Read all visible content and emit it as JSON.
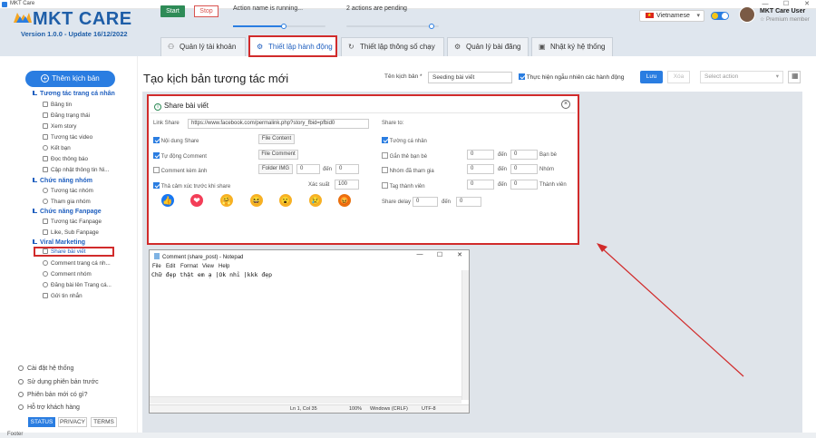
{
  "window": {
    "title": "MKT Care",
    "controls": [
      "—",
      "☐",
      "✕"
    ]
  },
  "header": {
    "logo_text": "MKT CARE",
    "version": "Version 1.0.0 - Update 16/12/2022",
    "start_label": "Start",
    "stop_label": "Stop",
    "status_running": "Action name is running...",
    "status_pending": "2 actions are pending",
    "running_progress": 0.55,
    "pending_progress": 0.92,
    "language": "Vietnamese",
    "user_name": "MKT Care User",
    "user_tier": "Premium member"
  },
  "tabs": [
    {
      "label": "Quản lý tài khoản",
      "icon": "account-icon"
    },
    {
      "label": "Thiết lập hành động",
      "icon": "gear-icon",
      "active": true
    },
    {
      "label": "Thiết lập thông số chạy",
      "icon": "refresh-icon"
    },
    {
      "label": "Quản lý bài đăng",
      "icon": "post-icon"
    },
    {
      "label": "Nhật ký hệ thống",
      "icon": "log-icon"
    }
  ],
  "sidebar": {
    "add_label": "Thêm kịch bản",
    "sections": [
      {
        "title": "Tương tác trang cá nhân",
        "items": [
          "Bảng tin",
          "Đăng trạng thái",
          "Xem story",
          "Tương tác video",
          "Kết bạn",
          "Đọc thông báo",
          "Cập nhật thông tin Ni..."
        ]
      },
      {
        "title": "Chức năng nhóm",
        "items": [
          "Tương tác nhóm",
          "Tham gia nhóm"
        ]
      },
      {
        "title": "Chức năng Fanpage",
        "items": [
          "Tương tác Fanpage",
          "Like, Sub Fanpage"
        ]
      },
      {
        "title": "Viral Marketing",
        "items": [
          "Share bài viết",
          "Comment trang cá nh...",
          "Comment nhóm",
          "Đăng bài lên Trang cá...",
          "Gửi tin nhắn"
        ]
      }
    ],
    "bottom": [
      "Cài đặt hệ thống",
      "Sử dụng phiên bản trước",
      "Phiên bản mới có gì?",
      "Hỗ trợ khách hàng"
    ],
    "footer_buttons": [
      "STATUS",
      "PRIVACY",
      "TERMS"
    ]
  },
  "main": {
    "title": "Tạo kịch bản tương tác mới",
    "script_name_label": "Tên kịch bản *",
    "script_name_value": "Seeding bài viết",
    "random_order_label": "Thực hiện ngẫu nhiên các hành động",
    "save_label": "Lưu",
    "delete_label": "Xóa",
    "select_action_placeholder": "Select action"
  },
  "card": {
    "title": "Share bài viết",
    "link_label": "Link Share",
    "link_value": "https://www.facebook.com/permalink.php?story_fbid=pfbid0",
    "content_share": "Nội dung Share",
    "file_content": "File Content",
    "auto_comment": "Tự động Comment",
    "file_comment": "File Comment",
    "comment_image": "Comment kèm ảnh",
    "folder_img": "Folder IMG",
    "img_from": "0",
    "img_to": "0",
    "den": "đến",
    "react_before_share": "Thả cảm xúc trước khi share",
    "probability_label": "Xác suất",
    "probability_value": "100",
    "share_to": "Share to:",
    "personal_page": "Tường cá nhân",
    "tag_friends": "Gắn thẻ bạn bè",
    "friends_unit": "Bạn bè",
    "joined_groups": "Nhóm đã tham gia",
    "groups_unit": "Nhóm",
    "tag_members": "Tag thành viên",
    "members_unit": "Thành viên",
    "share_delay": "Share delay",
    "zero": "0",
    "reactions": [
      "like-icon",
      "love-icon",
      "care-icon",
      "haha-icon",
      "wow-icon",
      "sad-icon",
      "angry-icon"
    ],
    "reaction_glyphs": [
      "👍",
      "❤",
      "🤗",
      "😆",
      "😮",
      "😢",
      "😡"
    ]
  },
  "notepad": {
    "title": "Comment (share_post) - Notepad",
    "menu": [
      "File",
      "Edit",
      "Format",
      "View",
      "Help"
    ],
    "content": "Chữ đẹp thật em ạ |Ok nhỉ |kkk đẹp",
    "status_pos": "Ln 1, Col 35",
    "status_zoom": "100%",
    "status_eol": "Windows (CRLF)",
    "status_enc": "UTF-8"
  },
  "footer_text": "Footer",
  "colors": {
    "accent": "#2a7de1",
    "highlight": "#d12b2b",
    "start": "#2e8b57"
  }
}
